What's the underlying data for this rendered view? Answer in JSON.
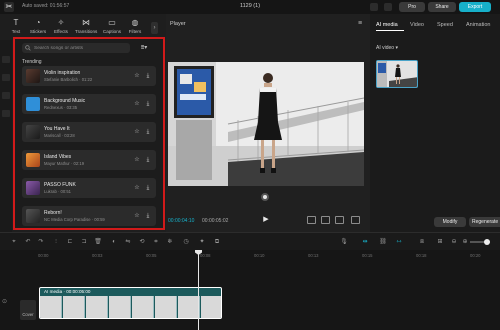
{
  "topbar": {
    "autosave": "Auto saved: 01:56:57",
    "title": "1129 (1)",
    "pro_label": "Pro",
    "share_label": "Share",
    "export_label": "Export"
  },
  "tools": [
    {
      "label": "Text",
      "icon": "text-icon"
    },
    {
      "label": "Stickers",
      "icon": "sticker-icon"
    },
    {
      "label": "Effects",
      "icon": "effects-icon"
    },
    {
      "label": "Transitions",
      "icon": "transitions-icon"
    },
    {
      "label": "Captions",
      "icon": "captions-icon"
    },
    {
      "label": "Filters",
      "icon": "filters-icon"
    }
  ],
  "music": {
    "search_placeholder": "Search songs or artists",
    "section_label": "Trending",
    "tracks": [
      {
        "title": "Violin inspiration",
        "meta": "Stefanie Barbolich · 01:22",
        "thumb_color": "#3a2a28"
      },
      {
        "title": "Background Music",
        "meta": "Rednexus · 03:35",
        "thumb_color": "#2f8fd8"
      },
      {
        "title": "You Have It",
        "meta": "Mariscall · 03:28",
        "thumb_color": "#2b2b2b"
      },
      {
        "title": "Island Vibes",
        "meta": "Mayur Mathur · 02:19",
        "thumb_color": "#d9691f"
      },
      {
        "title": "PASSO FUNK",
        "meta": "Lukrab · 00:51",
        "thumb_color": "#5a3b6c"
      },
      {
        "title": "Reborn!",
        "meta": "NC Media Corp Paradise · 00:59",
        "thumb_color": "#2e2e2e"
      }
    ]
  },
  "player": {
    "title": "Player",
    "time_current": "00:00:04:10",
    "time_total": "00:00:05:02"
  },
  "right": {
    "tabs": [
      "AI media",
      "Video",
      "Speed",
      "Animation"
    ],
    "ai_video_label": "AI video",
    "modify_label": "Modify",
    "regenerate_label": "Regenerate"
  },
  "timeline": {
    "ticks": [
      "00:00",
      "00:03",
      "00:05",
      "00:08",
      "00:10",
      "00:13",
      "00:15",
      "00:18",
      "00:20"
    ],
    "clip_label": "AI media · 00:00:05:00",
    "cover_label": "Cover"
  },
  "colors": {
    "accent": "#17b0c9",
    "highlight_border": "#d11a1a"
  }
}
